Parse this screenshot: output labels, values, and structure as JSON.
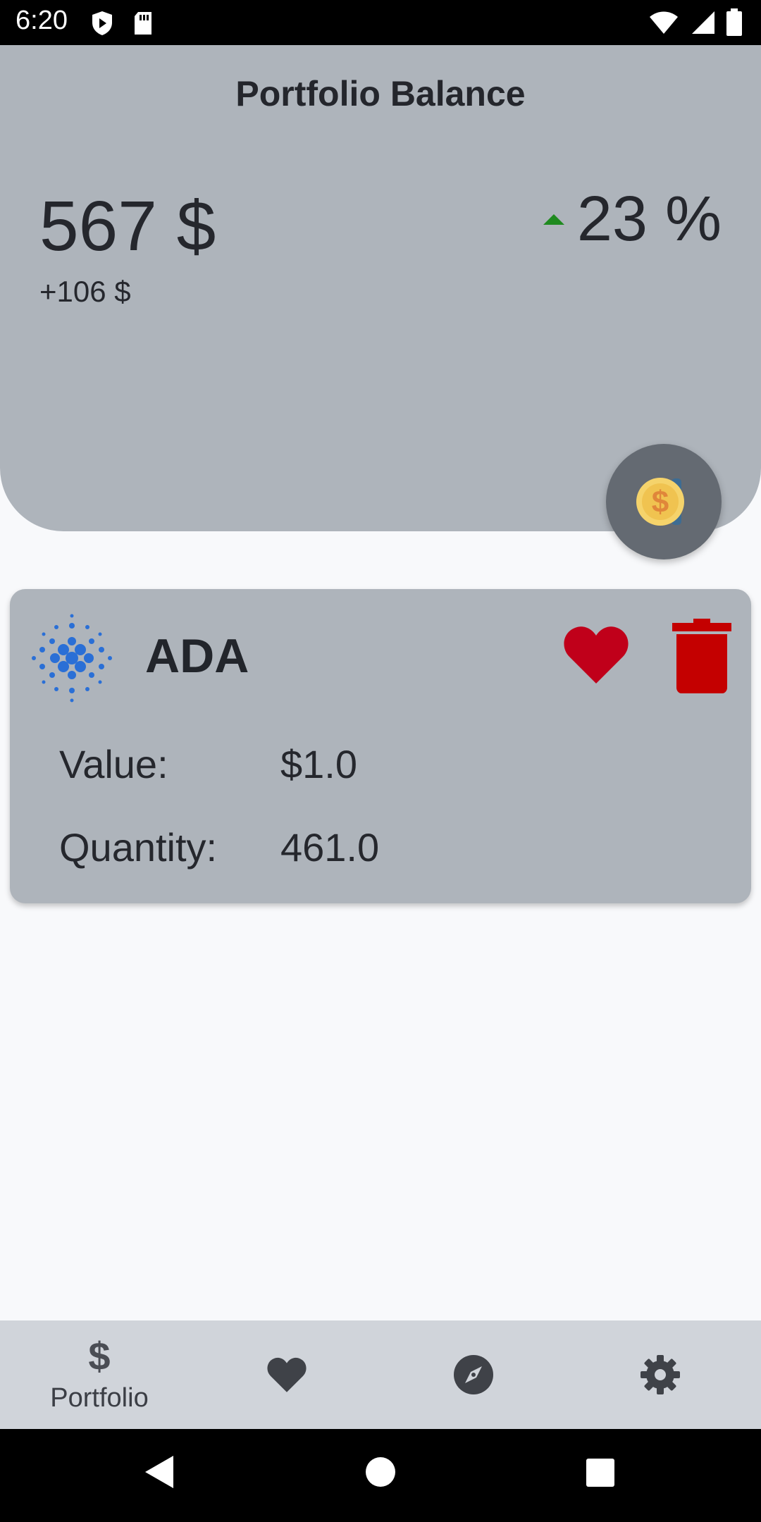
{
  "status_bar": {
    "time": "6:20",
    "icons_left": [
      "shield-play-icon",
      "sd-card-icon"
    ],
    "icons_right": [
      "wifi-icon",
      "signal-icon",
      "battery-icon"
    ]
  },
  "balance": {
    "title": "Portfolio Balance",
    "value": "567 $",
    "change": "+106 $",
    "percent": "23 %",
    "trend": "up",
    "trend_color": "#1f8a1f"
  },
  "fab": {
    "icon": "coin-dollar-icon"
  },
  "coins": [
    {
      "symbol": "ADA",
      "logo": "cardano-logo",
      "value_label": "Value:",
      "value": "$1.0",
      "quantity_label": "Quantity:",
      "quantity": "461.0",
      "favorite_color": "#c0001a",
      "delete_color": "#c40000"
    }
  ],
  "bottom_nav": {
    "items": [
      {
        "icon": "dollar-icon",
        "label": "Portfolio",
        "active": true
      },
      {
        "icon": "heart-icon",
        "label": "",
        "active": false
      },
      {
        "icon": "compass-icon",
        "label": "",
        "active": false
      },
      {
        "icon": "gear-icon",
        "label": "",
        "active": false
      }
    ]
  },
  "system_nav": [
    "back-icon",
    "home-icon",
    "recents-icon"
  ],
  "colors": {
    "card_bg": "#aeb4bb",
    "page_bg": "#f8f9fb",
    "nav_bg": "#d0d4da",
    "accent_blue": "#2a6fd6"
  }
}
